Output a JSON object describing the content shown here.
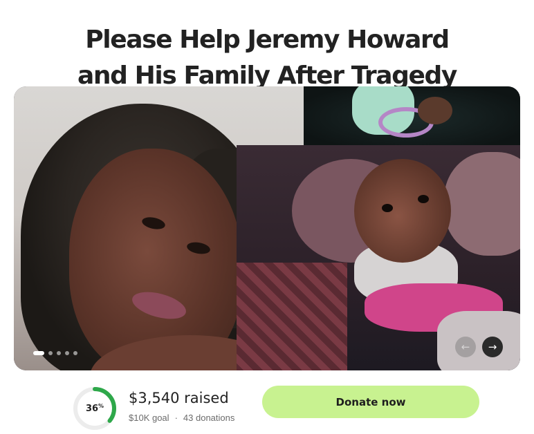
{
  "campaign": {
    "title_line1": "Please Help Jeremy Howard",
    "title_line2": "and His Family After Tragedy"
  },
  "gallery": {
    "slide_count": 5,
    "active_slide": 1,
    "prev_icon": "arrow-left-icon",
    "next_icon": "arrow-right-icon",
    "prev_glyph": "←",
    "next_glyph": "→"
  },
  "fundraising": {
    "progress_value": "36",
    "progress_unit": "%",
    "progress_fraction": 0.36,
    "raised_text": "$3,540 raised",
    "goal_text": "$10K goal",
    "separator": "·",
    "donations_text": "43 donations",
    "progress_color": "#2ea84a",
    "track_color": "#ececec"
  },
  "cta": {
    "donate_label": "Donate now",
    "button_color": "#c8f290"
  }
}
